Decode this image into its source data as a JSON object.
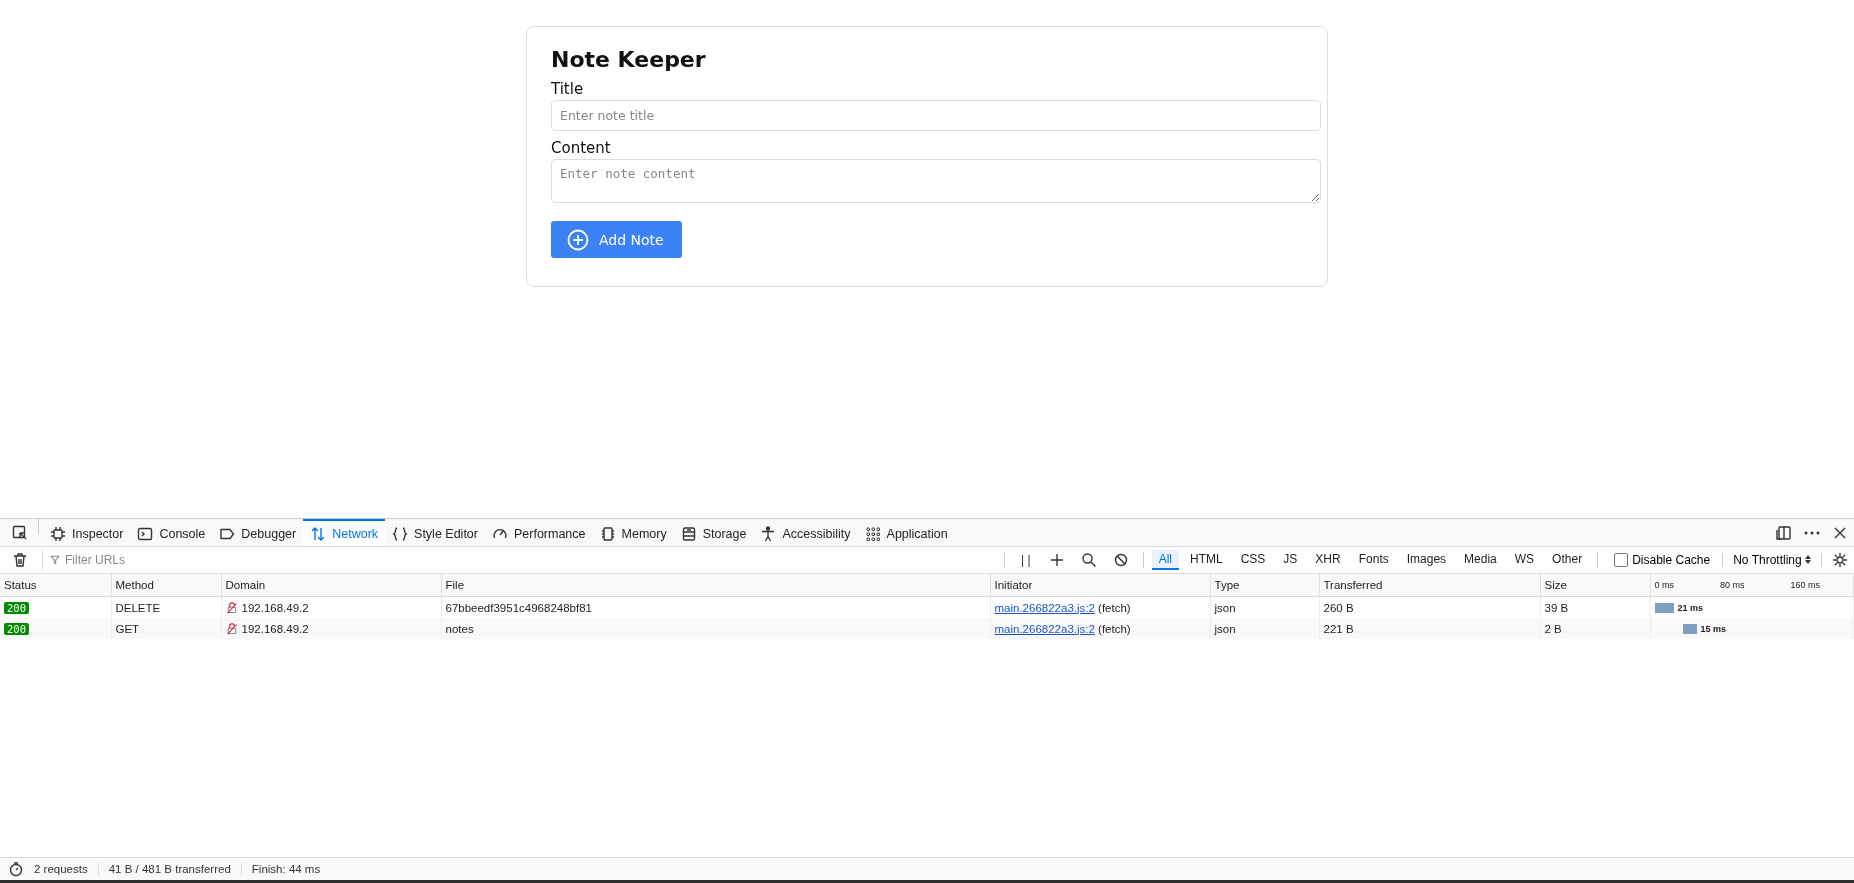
{
  "app": {
    "title": "Note Keeper",
    "fields": [
      {
        "label": "Title",
        "placeholder": "Enter note title",
        "kind": "input"
      },
      {
        "label": "Content",
        "placeholder": "Enter note content",
        "kind": "textarea"
      }
    ],
    "button": "Add Note"
  },
  "devtools": {
    "tabs": [
      {
        "label": "Inspector",
        "selected": false
      },
      {
        "label": "Console",
        "selected": false
      },
      {
        "label": "Debugger",
        "selected": false
      },
      {
        "label": "Network",
        "selected": true
      },
      {
        "label": "Style Editor",
        "selected": false
      },
      {
        "label": "Performance",
        "selected": false
      },
      {
        "label": "Memory",
        "selected": false
      },
      {
        "label": "Storage",
        "selected": false
      },
      {
        "label": "Accessibility",
        "selected": false
      },
      {
        "label": "Application",
        "selected": false
      }
    ],
    "filter": {
      "placeholder": "Filter URLs"
    },
    "pause_label": "| |",
    "type_filters": [
      {
        "label": "All",
        "selected": true
      },
      {
        "label": "HTML",
        "selected": false
      },
      {
        "label": "CSS",
        "selected": false
      },
      {
        "label": "JS",
        "selected": false
      },
      {
        "label": "XHR",
        "selected": false
      },
      {
        "label": "Fonts",
        "selected": false
      },
      {
        "label": "Images",
        "selected": false
      },
      {
        "label": "Media",
        "selected": false
      },
      {
        "label": "WS",
        "selected": false
      },
      {
        "label": "Other",
        "selected": false
      }
    ],
    "disable_cache": {
      "label": "Disable Cache",
      "checked": false
    },
    "throttling": "No Throttling",
    "table": {
      "columns": [
        "Status",
        "Method",
        "Domain",
        "File",
        "Initiator",
        "Type",
        "Transferred",
        "Size"
      ],
      "waterfall_ticks": [
        "0 ms",
        "80 ms",
        "160 ms"
      ],
      "rows": [
        {
          "status": "200",
          "method": "DELETE",
          "domain": "192.168.49.2",
          "file": "67bbeedf3951c4968248bf81",
          "initiator_link": "main.266822a3.js:2",
          "initiator_cause": "(fetch)",
          "type": "json",
          "transferred": "260 B",
          "size": "39 B",
          "timing": "21 ms"
        },
        {
          "status": "200",
          "method": "GET",
          "domain": "192.168.49.2",
          "file": "notes",
          "initiator_link": "main.266822a3.js:2",
          "initiator_cause": "(fetch)",
          "type": "json",
          "transferred": "221 B",
          "size": "2 B",
          "timing": "15 ms"
        }
      ]
    },
    "status_bar": [
      "2 requests",
      "41 B / 481 B transferred",
      "Finish: 44 ms"
    ]
  }
}
